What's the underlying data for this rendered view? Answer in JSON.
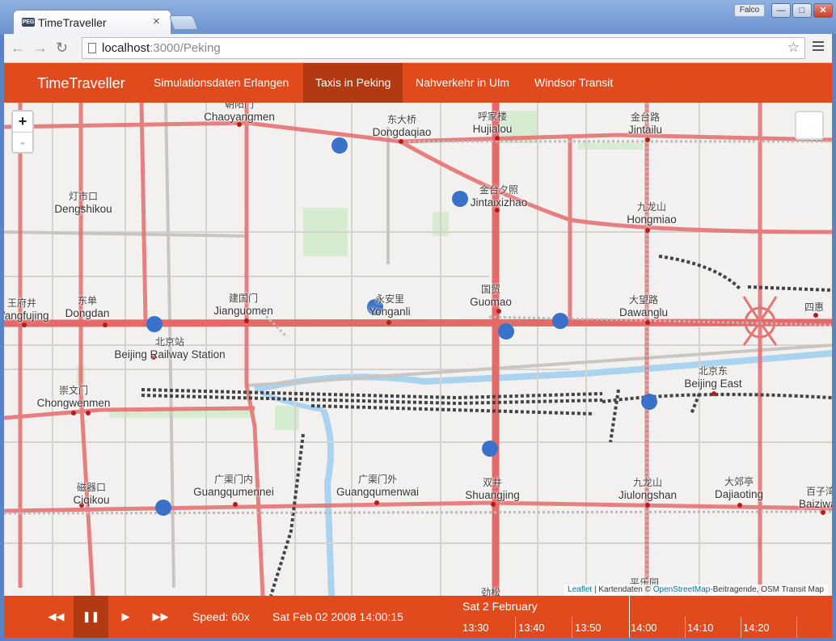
{
  "browser": {
    "tab_title": "TimeTraveller",
    "favicon_text": "PEG",
    "user": "Falco",
    "url_host": "localhost",
    "url_rest": ":3000/Peking"
  },
  "app": {
    "brand": "TimeTraveller",
    "nav": [
      {
        "label": "Simulationsdaten Erlangen"
      },
      {
        "label": "Taxis in Peking"
      },
      {
        "label": "Nahverkehr in Ulm"
      },
      {
        "label": "Windsor Transit"
      }
    ],
    "active_nav": "Taxis in Peking"
  },
  "map": {
    "zoom_in": "+",
    "zoom_out": "-",
    "attribution": {
      "leaflet": "Leaflet",
      "sep": " | Kartendaten © ",
      "osm": "OpenStreetMap",
      "rest": "-Beitragende, OSM Transit Map"
    },
    "places": [
      {
        "zh": "朝阳门",
        "en": "Chaoyangmen"
      },
      {
        "zh": "东大桥",
        "en": "Dongdaqiao"
      },
      {
        "zh": "呼家楼",
        "en": "Hujialou"
      },
      {
        "zh": "金台路",
        "en": "Jintailu"
      },
      {
        "zh": "灯市口",
        "en": "Dengshikou"
      },
      {
        "zh": "金台夕照",
        "en": "Jintaixizhao"
      },
      {
        "zh": "九龙山",
        "en": "Hongmiao"
      },
      {
        "zh": "王府井",
        "en": "Wangfujing"
      },
      {
        "zh": "东单",
        "en": "Dongdan"
      },
      {
        "zh": "建国门",
        "en": "Jianguomen"
      },
      {
        "zh": "永安里",
        "en": "Yonganli"
      },
      {
        "zh": "国贸",
        "en": "Guomao"
      },
      {
        "zh": "大望路",
        "en": "Dawanglu"
      },
      {
        "zh": "四惠",
        "en": ""
      },
      {
        "zh": "北京站",
        "en": "Beijing Railway Station"
      },
      {
        "zh": "北京东",
        "en": "Beijing East"
      },
      {
        "zh": "崇文门",
        "en": "Chongwenmen"
      },
      {
        "zh": "磁器口",
        "en": "Ciqikou"
      },
      {
        "zh": "广渠门内",
        "en": "Guangqumennei"
      },
      {
        "zh": "广渠门外",
        "en": "Guangqumenwai"
      },
      {
        "zh": "双井",
        "en": "Shuangjing"
      },
      {
        "zh": "九龙山",
        "en": "Jiulongshan"
      },
      {
        "zh": "大郊亭",
        "en": "Dajiaoting"
      },
      {
        "zh": "百子湾",
        "en": "Baiziwan"
      },
      {
        "zh": "劲松",
        "en": ""
      },
      {
        "zh": "平乐园",
        "en": ""
      }
    ],
    "taxi_count": 10
  },
  "playback": {
    "speed": "Speed: 60x",
    "clock": "Sat Feb 02 2008 14:00:15",
    "timeline_date": "Sat 2 February",
    "timeline_ticks": [
      "13:30",
      "13:40",
      "13:50",
      "14:00",
      "14:10",
      "14:20"
    ],
    "state": "playing"
  },
  "colors": {
    "accent": "#e04a1c",
    "accent_dark": "#b23a12",
    "taxi": "#3a72c9",
    "road_major": "#e57373",
    "water": "#aad3f0"
  }
}
